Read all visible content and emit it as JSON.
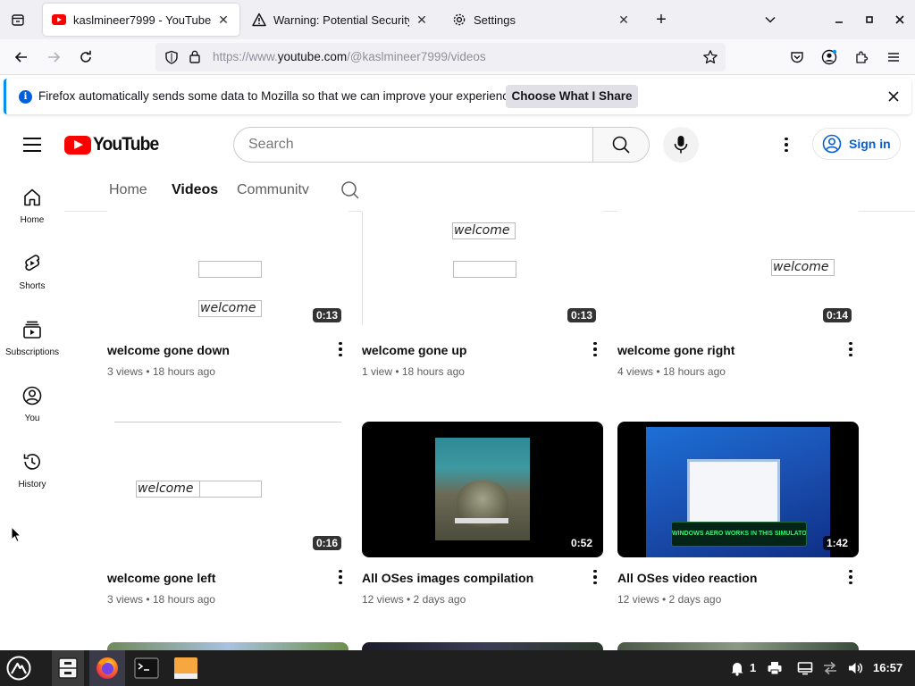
{
  "browser": {
    "tabs": [
      {
        "title": "kaslmineer7999 - YouTube",
        "active": true
      },
      {
        "title": "Warning: Potential Security R",
        "active": false
      },
      {
        "title": "Settings",
        "active": false
      }
    ],
    "url_prefix": "https://www.",
    "url_domain": "youtube.com",
    "url_path": "/@kaslmineer7999/videos"
  },
  "notification": {
    "info_glyph": "i",
    "message": "Firefox automatically sends some data to Mozilla so that we can improve your experience.",
    "button": "Choose What I Share"
  },
  "youtube": {
    "logo_text": "YouTube",
    "search_placeholder": "Search",
    "sign_in": "Sign in",
    "rail": [
      {
        "label": "Home",
        "icon": "home-icon"
      },
      {
        "label": "Shorts",
        "icon": "shorts-icon"
      },
      {
        "label": "Subscriptions",
        "icon": "subscriptions-icon"
      },
      {
        "label": "You",
        "icon": "you-icon"
      },
      {
        "label": "History",
        "icon": "history-icon"
      }
    ],
    "channel_tabs": [
      {
        "label": "Home",
        "selected": false
      },
      {
        "label": "Videos",
        "selected": true
      },
      {
        "label": "Community",
        "selected": false
      }
    ],
    "videos": [
      {
        "title": "welcome gone down",
        "meta": "3 views • 18 hours ago",
        "duration": "0:13",
        "thumb_text": "welcome"
      },
      {
        "title": "welcome gone up",
        "meta": "1 view • 18 hours ago",
        "duration": "0:13",
        "thumb_text": "welcome"
      },
      {
        "title": "welcome gone right",
        "meta": "4 views • 18 hours ago",
        "duration": "0:14",
        "thumb_text": "welcome"
      },
      {
        "title": "welcome gone left",
        "meta": "3 views • 18 hours ago",
        "duration": "0:16",
        "thumb_text": "welcome"
      },
      {
        "title": "All OSes images compilation",
        "meta": "12 views • 2 days ago",
        "duration": "0:52",
        "thumb_text": ""
      },
      {
        "title": "All OSes video reaction",
        "meta": "12 views • 2 days ago",
        "duration": "1:42",
        "thumb_text": "WINDOWS AERO WORKS IN THIS SIMULATOR"
      }
    ]
  },
  "taskbar": {
    "notification_count": "1",
    "clock": "16:57"
  },
  "colors": {
    "youtube_red": "#ff0000",
    "link_blue": "#065fd4",
    "firefox_blue": "#0060df"
  }
}
